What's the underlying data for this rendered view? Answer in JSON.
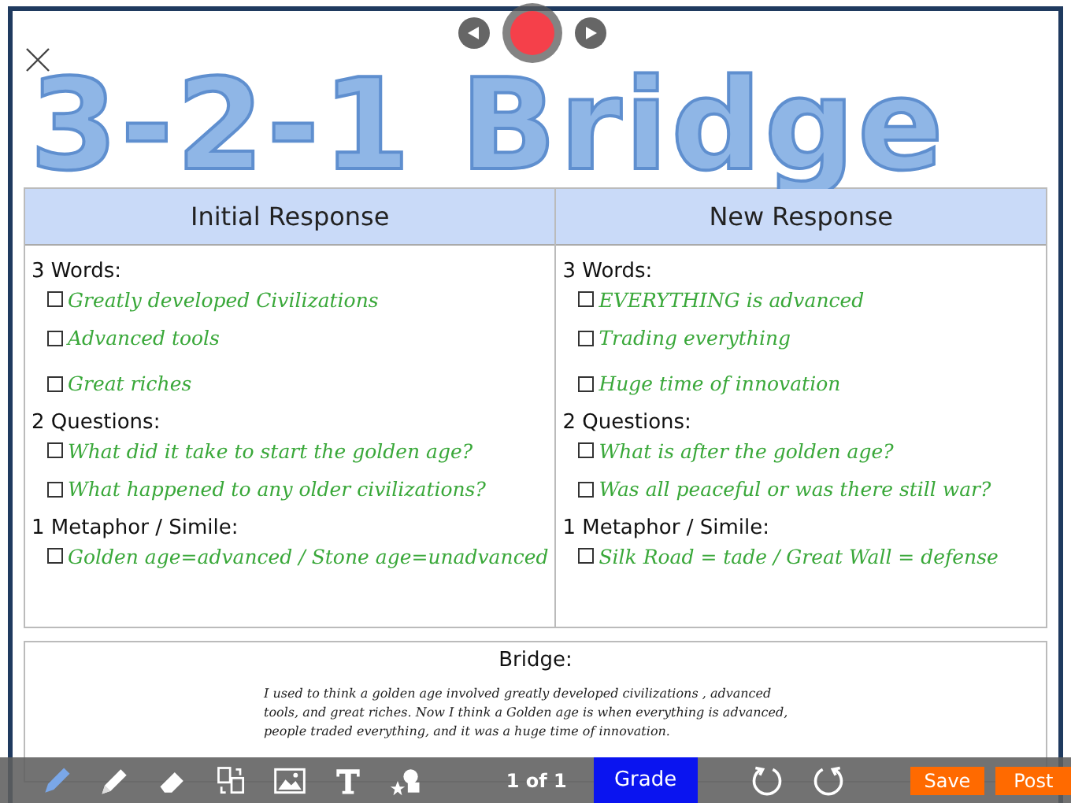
{
  "title": "3-2-1 Bridge",
  "recorder": {
    "recording": true
  },
  "columns": [
    {
      "heading": "Initial Response",
      "sections": [
        {
          "label": "3 Words:",
          "items": [
            {
              "text": "Greatly developed Civilizations",
              "checked": false
            },
            {
              "text": "Advanced  tools",
              "checked": false
            },
            {
              "text": "Great riches",
              "checked": false
            }
          ]
        },
        {
          "label": "2 Questions:",
          "items": [
            {
              "text": "What did it take to start the golden age?",
              "checked": false
            },
            {
              "text": "What happened to any older civilizations?",
              "checked": false
            }
          ]
        },
        {
          "label": "1 Metaphor / Simile:",
          "items": [
            {
              "text": "Golden age=advanced / Stone age=unadvanced",
              "checked": false
            }
          ]
        }
      ]
    },
    {
      "heading": "New Response",
      "sections": [
        {
          "label": "3 Words:",
          "items": [
            {
              "text": "EVERYTHING is advanced",
              "checked": false
            },
            {
              "text": "Trading everything",
              "checked": false
            },
            {
              "text": "Huge time of innovation",
              "checked": false
            }
          ]
        },
        {
          "label": "2 Questions:",
          "items": [
            {
              "text": "What is after the golden age?",
              "checked": false
            },
            {
              "text": "Was all peaceful or was there still war?",
              "checked": false
            }
          ]
        },
        {
          "label": "1 Metaphor / Simile:",
          "items": [
            {
              "text": "Silk Road = tade / Great Wall = defense",
              "checked": false
            }
          ]
        }
      ]
    }
  ],
  "bridge": {
    "heading": "Bridge:",
    "text": "I used to think a golden age involved greatly developed civilizations , advanced tools, and great riches. Now I think a Golden age is when everything is advanced, people traded everything, and it was a huge time of innovation."
  },
  "toolbar": {
    "tools": [
      {
        "kind": "pen",
        "selected": true
      },
      {
        "kind": "highlighter",
        "selected": false
      },
      {
        "kind": "eraser",
        "selected": false
      },
      {
        "kind": "pages",
        "selected": false
      },
      {
        "kind": "image",
        "selected": false
      },
      {
        "kind": "text",
        "selected": false
      },
      {
        "kind": "shapes",
        "selected": false
      }
    ],
    "page_indicator": "1 of 1",
    "grade": "Grade",
    "history": [
      {
        "kind": "undo"
      },
      {
        "kind": "redo"
      }
    ],
    "save": "Save",
    "post": "Post"
  }
}
